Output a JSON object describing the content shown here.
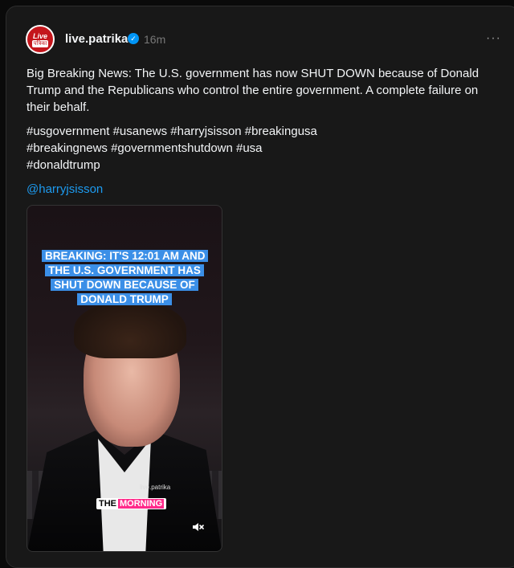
{
  "post": {
    "avatar": {
      "line1": "Live",
      "line2": "पत्रिका"
    },
    "username": "live.patrika",
    "time": "16m",
    "more_label": "···",
    "text": "Big Breaking News: The U.S. government has now SHUT DOWN because of Donald Trump and the Republicans who control the entire government. A complete failure on their behalf.",
    "hashtags": [
      "#usgovernment #usanews #harryjsisson #breakingusa",
      "#breakingnews #governmentshutdown #usa",
      "#donaldtrump"
    ],
    "mention": "@harryjsisson"
  },
  "video": {
    "headline": "BREAKING: IT'S 12:01 AM AND THE U.S. GOVERNMENT HAS SHUT DOWN BECAUSE OF DONALD TRUMP",
    "watermark": "live.patrika",
    "caption_word1": "THE",
    "caption_word2": "MORNING"
  },
  "colors": {
    "accent": "#1d9bf0",
    "verified": "#0095f6",
    "headline_bg": "#3b8fe7"
  }
}
